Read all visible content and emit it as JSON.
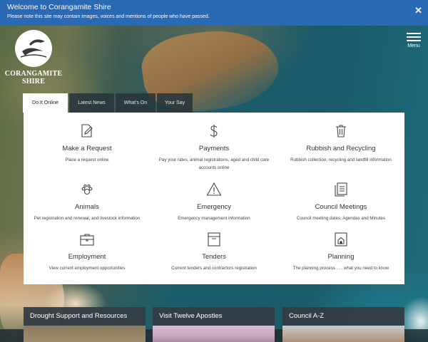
{
  "notice": {
    "title": "Welcome to Corangamite Shire",
    "text": "Please note this site may contain images, voices and mentions of people who have passed.",
    "close_label": "✕"
  },
  "logo": {
    "line1": "CORANGAMITE",
    "line2": "SHIRE"
  },
  "menu": {
    "label": "Menu"
  },
  "tabs": [
    {
      "label": "Do It Online",
      "active": true
    },
    {
      "label": "Latest News",
      "active": false
    },
    {
      "label": "What's On",
      "active": false
    },
    {
      "label": "Your Say",
      "active": false
    }
  ],
  "services": [
    {
      "title": "Make a Request",
      "desc": "Place a request online",
      "icon": "edit-document-icon"
    },
    {
      "title": "Payments",
      "desc": "Pay your rates, animal registrations, aged and child care accounts online",
      "icon": "dollar-icon"
    },
    {
      "title": "Rubbish and Recycling",
      "desc": "Rubbish collection, recycling and landfill information",
      "icon": "bin-icon"
    },
    {
      "title": "Animals",
      "desc": "Pet registration and renewal, and livestock information",
      "icon": "paw-icon"
    },
    {
      "title": "Emergency",
      "desc": "Emergency management information",
      "icon": "warning-icon"
    },
    {
      "title": "Council Meetings",
      "desc": "Council meeting dates, Agendas and Minutes",
      "icon": "documents-icon"
    },
    {
      "title": "Employment",
      "desc": "View current employment opportunities",
      "icon": "briefcase-icon"
    },
    {
      "title": "Tenders",
      "desc": "Current tenders and contractors registration",
      "icon": "tender-box-icon"
    },
    {
      "title": "Planning",
      "desc": "The planning process . . . what you need to know",
      "icon": "house-plan-icon"
    }
  ],
  "tiles": [
    {
      "title": "Drought Support and Resources"
    },
    {
      "title": "Visit Twelve Apostles"
    },
    {
      "title": "Council A-Z"
    }
  ],
  "colors": {
    "notice_bar": "#2a69b3",
    "tab_inactive": "#28343c",
    "tile_header": "#343c44"
  }
}
